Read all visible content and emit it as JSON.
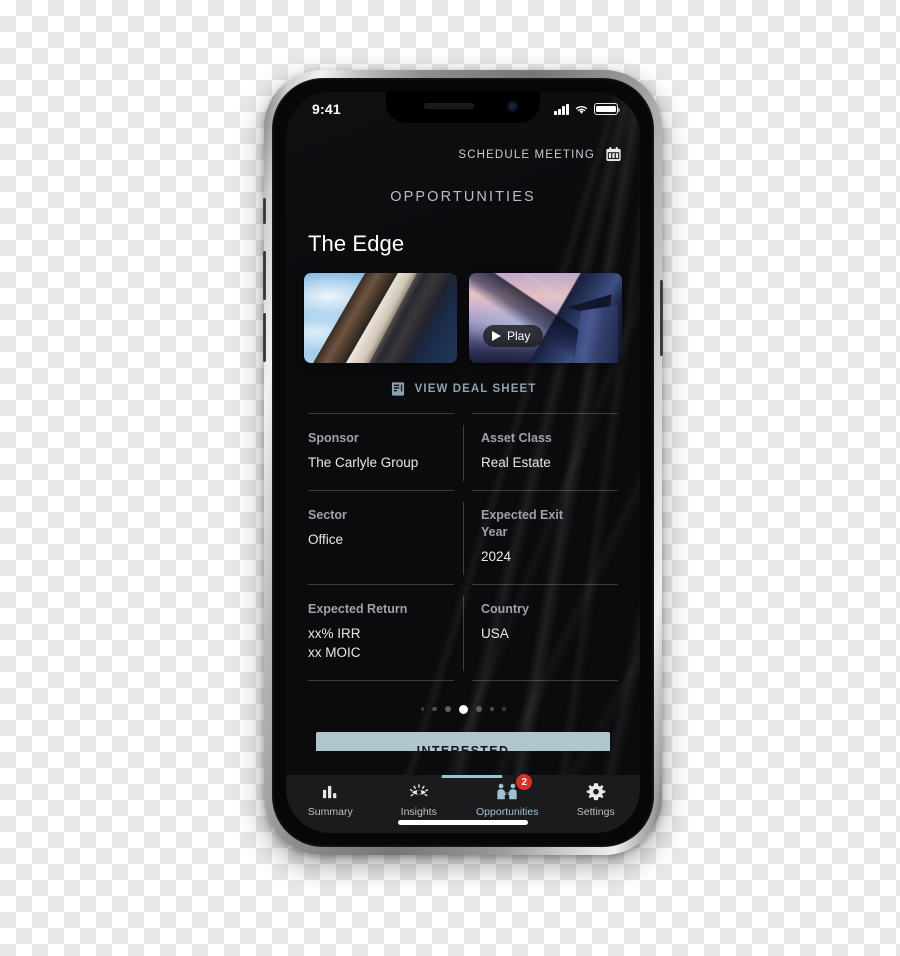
{
  "status_bar": {
    "time": "9:41",
    "signal_icon": "cellular-signal-icon",
    "wifi_icon": "wifi-icon",
    "battery_icon": "battery-full-icon"
  },
  "header": {
    "schedule_label": "SCHEDULE MEETING",
    "calendar_icon": "calendar-icon",
    "page_title": "OPPORTUNITIES"
  },
  "deal": {
    "name": "The Edge",
    "media": [
      {
        "id": "building-photo",
        "alt": "building-facade-photo",
        "has_play": false
      },
      {
        "id": "city-photo",
        "alt": "city-skyline-dusk-photo",
        "has_play": true,
        "play_label": "Play"
      }
    ],
    "deal_sheet_label": "VIEW DEAL SHEET",
    "deal_sheet_icon": "document-icon",
    "details": [
      [
        {
          "key": "Sponsor",
          "value": "The Carlyle Group"
        },
        {
          "key": "Asset Class",
          "value": "Real Estate"
        }
      ],
      [
        {
          "key": "Sector",
          "value": "Office"
        },
        {
          "key": "Expected Exit\nYear",
          "value": "2024"
        }
      ],
      [
        {
          "key": "Expected Return",
          "value": "xx% IRR\nxx MOIC"
        },
        {
          "key": "Country",
          "value": "USA"
        }
      ]
    ]
  },
  "pager": {
    "total": 7,
    "active_index": 3
  },
  "cta": {
    "interested_label": "INTERESTED"
  },
  "tab_bar": {
    "active_index": 2,
    "items": [
      {
        "label": "Summary",
        "icon": "bar-chart-icon",
        "badge": null
      },
      {
        "label": "Insights",
        "icon": "eye-icon",
        "badge": null
      },
      {
        "label": "Opportunities",
        "icon": "handshake-people-icon",
        "badge": "2"
      },
      {
        "label": "Settings",
        "icon": "gear-icon",
        "badge": null
      }
    ]
  },
  "colors": {
    "accent": "#9EC4D4",
    "cta_background": "#B1C5CC",
    "badge": "#D93025",
    "screen_background": "#0B0B0E",
    "tab_bar_background": "#1B1B1D"
  }
}
